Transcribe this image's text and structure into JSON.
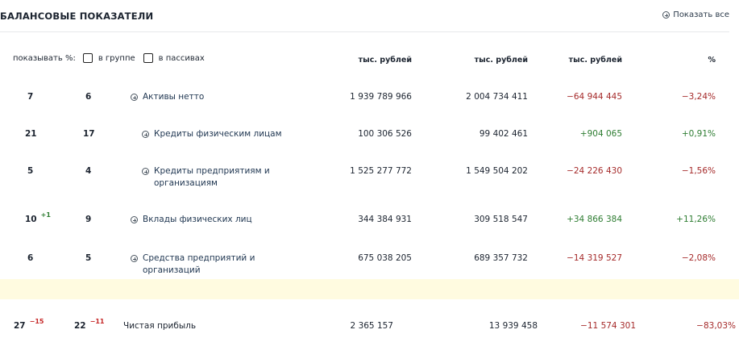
{
  "header": {
    "title": "БАЛАНСОВЫЕ ПОКАЗАТЕЛИ",
    "show_all": "Показать все"
  },
  "filter": {
    "label": "показывать %:",
    "in_group": "в группе",
    "in_liabilities": "в пассивах"
  },
  "columns": [
    "тыс. рублей",
    "тыс. рублей",
    "тыс. рублей",
    "%"
  ],
  "rows": [
    {
      "rank1": "7",
      "rank1_delta": "",
      "rank2": "6",
      "rank2_delta": "",
      "name": "Активы нетто",
      "v1": "1 939 789 966",
      "v2": "2 004 734 411",
      "diff": "−64 944 445",
      "pct": "−3,24%",
      "sign": "neg"
    },
    {
      "rank1": "21",
      "rank1_delta": "",
      "rank2": "17",
      "rank2_delta": "",
      "name": "Кредиты физическим лицам",
      "v1": "100 306 526",
      "v2": "99 402 461",
      "diff": "+904 065",
      "pct": "+0,91%",
      "sign": "pos"
    },
    {
      "rank1": "5",
      "rank1_delta": "",
      "rank2": "4",
      "rank2_delta": "",
      "name": "Кредиты предприятиям и организациям",
      "v1": "1 525 277 772",
      "v2": "1 549 504 202",
      "diff": "−24 226 430",
      "pct": "−1,56%",
      "sign": "neg"
    },
    {
      "rank1": "10",
      "rank1_delta": "+1",
      "rank2": "9",
      "rank2_delta": "",
      "name": "Вклады физических лиц",
      "v1": "344 384 931",
      "v2": "309 518 547",
      "diff": "+34 866 384",
      "pct": "+11,26%",
      "sign": "pos"
    },
    {
      "rank1": "6",
      "rank1_delta": "",
      "rank2": "5",
      "rank2_delta": "",
      "name": "Средства предприятий и организаций",
      "v1": "675 038 205",
      "v2": "689 357 732",
      "diff": "−14 319 527",
      "pct": "−2,08%",
      "sign": "neg"
    }
  ],
  "profit": {
    "rank1": "27",
    "rank1_delta": "−15",
    "rank2": "22",
    "rank2_delta": "−11",
    "name": "Чистая прибыль",
    "v1": "2 365 157",
    "v2": "13 939 458",
    "diff": "−11 574 301",
    "pct": "−83,03%"
  }
}
